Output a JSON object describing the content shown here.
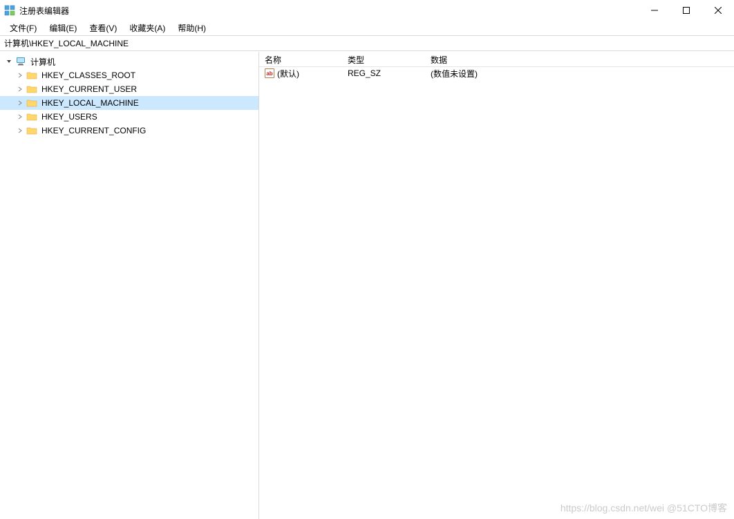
{
  "window": {
    "title": "注册表编辑器"
  },
  "menu": {
    "file": "文件(F)",
    "edit": "编辑(E)",
    "view": "查看(V)",
    "favorites": "收藏夹(A)",
    "help": "帮助(H)"
  },
  "address": "计算机\\HKEY_LOCAL_MACHINE",
  "tree": {
    "root": "计算机",
    "keys": [
      "HKEY_CLASSES_ROOT",
      "HKEY_CURRENT_USER",
      "HKEY_LOCAL_MACHINE",
      "HKEY_USERS",
      "HKEY_CURRENT_CONFIG"
    ],
    "selected_index": 2
  },
  "values": {
    "columns": {
      "name": "名称",
      "type": "类型",
      "data": "数据"
    },
    "rows": [
      {
        "name": "(默认)",
        "type": "REG_SZ",
        "data": "(数值未设置)"
      }
    ]
  },
  "watermark": "https://blog.csdn.net/wei @51CTO博客"
}
